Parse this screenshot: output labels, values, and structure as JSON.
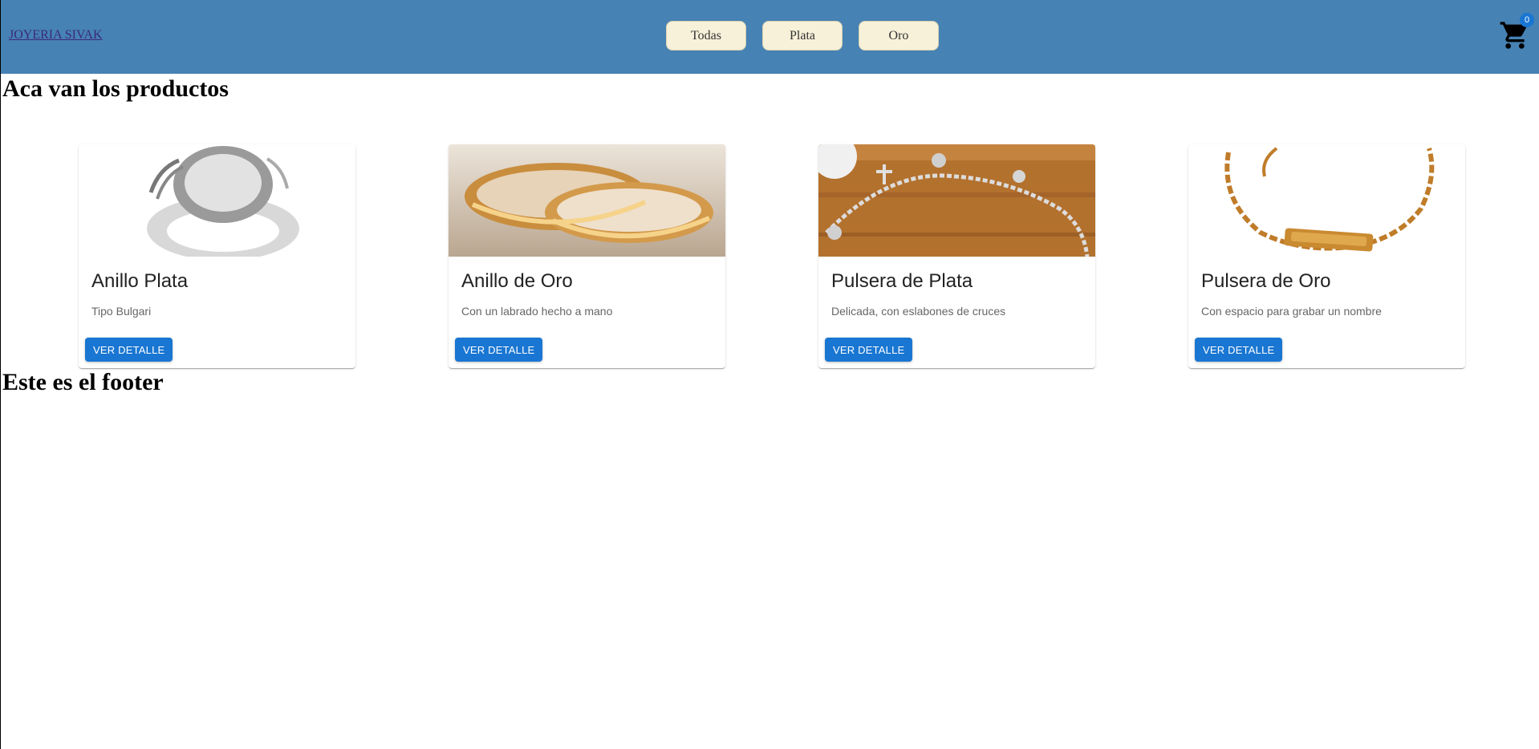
{
  "navbar": {
    "brand": "JOYERIA SIVAK",
    "buttons": [
      "Todas",
      "Plata",
      "Oro"
    ],
    "cart_count": "0",
    "bg_color": "#4682b4"
  },
  "main": {
    "products_title": "Aca van los productos",
    "footer_title": "Este es el footer"
  },
  "products": [
    {
      "title": "Anillo Plata",
      "desc": "Tipo Bulgari",
      "button": "VER DETALLE",
      "image": "silver-ring"
    },
    {
      "title": "Anillo de Oro",
      "desc": "Con un labrado hecho a mano",
      "button": "VER DETALLE",
      "image": "gold-rings"
    },
    {
      "title": "Pulsera de Plata",
      "desc": "Delicada, con eslabones de cruces",
      "button": "VER DETALLE",
      "image": "silver-bracelet"
    },
    {
      "title": "Pulsera de Oro",
      "desc": "Con espacio para grabar un nombre",
      "button": "VER DETALLE",
      "image": "gold-bracelet"
    }
  ],
  "icons": {
    "cart": "shopping-cart-icon"
  }
}
